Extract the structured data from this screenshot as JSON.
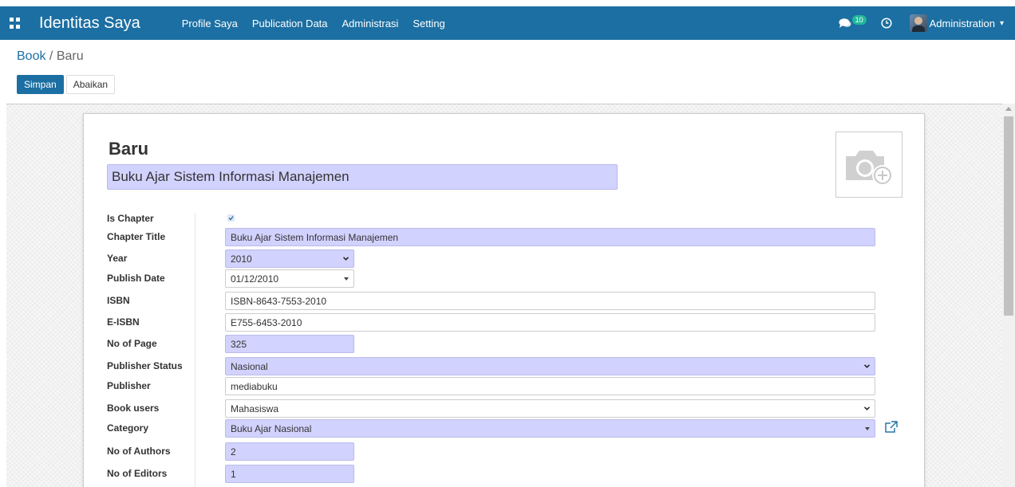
{
  "app": {
    "title": "Identitas Saya"
  },
  "menu": [
    "Profile Saya",
    "Publication Data",
    "Administrasi",
    "Setting"
  ],
  "topbar": {
    "message_count": "10",
    "user_name": "Administration"
  },
  "breadcrumb": {
    "parent": "Book",
    "separator": " / ",
    "current": "Baru"
  },
  "actions": {
    "save": "Simpan",
    "discard": "Abaikan"
  },
  "record": {
    "heading": "Baru",
    "name": "Buku Ajar Sistem Informasi Manajemen"
  },
  "fields": {
    "is_chapter": {
      "label": "Is Chapter",
      "checked": true
    },
    "chapter_title": {
      "label": "Chapter Title",
      "value": "Buku Ajar Sistem Informasi Manajemen"
    },
    "year": {
      "label": "Year",
      "value": "2010"
    },
    "publish_date": {
      "label": "Publish Date",
      "value": "01/12/2010"
    },
    "isbn": {
      "label": "ISBN",
      "value": "ISBN-8643-7553-2010"
    },
    "eisbn": {
      "label": "E-ISBN",
      "value": "E755-6453-2010"
    },
    "no_of_page": {
      "label": "No of Page",
      "value": "325"
    },
    "publisher_status": {
      "label": "Publisher Status",
      "value": "Nasional"
    },
    "publisher": {
      "label": "Publisher",
      "value": "mediabuku"
    },
    "book_users": {
      "label": "Book users",
      "value": "Mahasiswa"
    },
    "category": {
      "label": "Category",
      "value": "Buku Ajar Nasional"
    },
    "no_of_authors": {
      "label": "No of Authors",
      "value": "2"
    },
    "no_of_editors": {
      "label": "No of Editors",
      "value": "1"
    }
  },
  "colors": {
    "navbar": "#1c6fa2",
    "required_field": "#d2d2ff",
    "badge": "#21b799"
  }
}
